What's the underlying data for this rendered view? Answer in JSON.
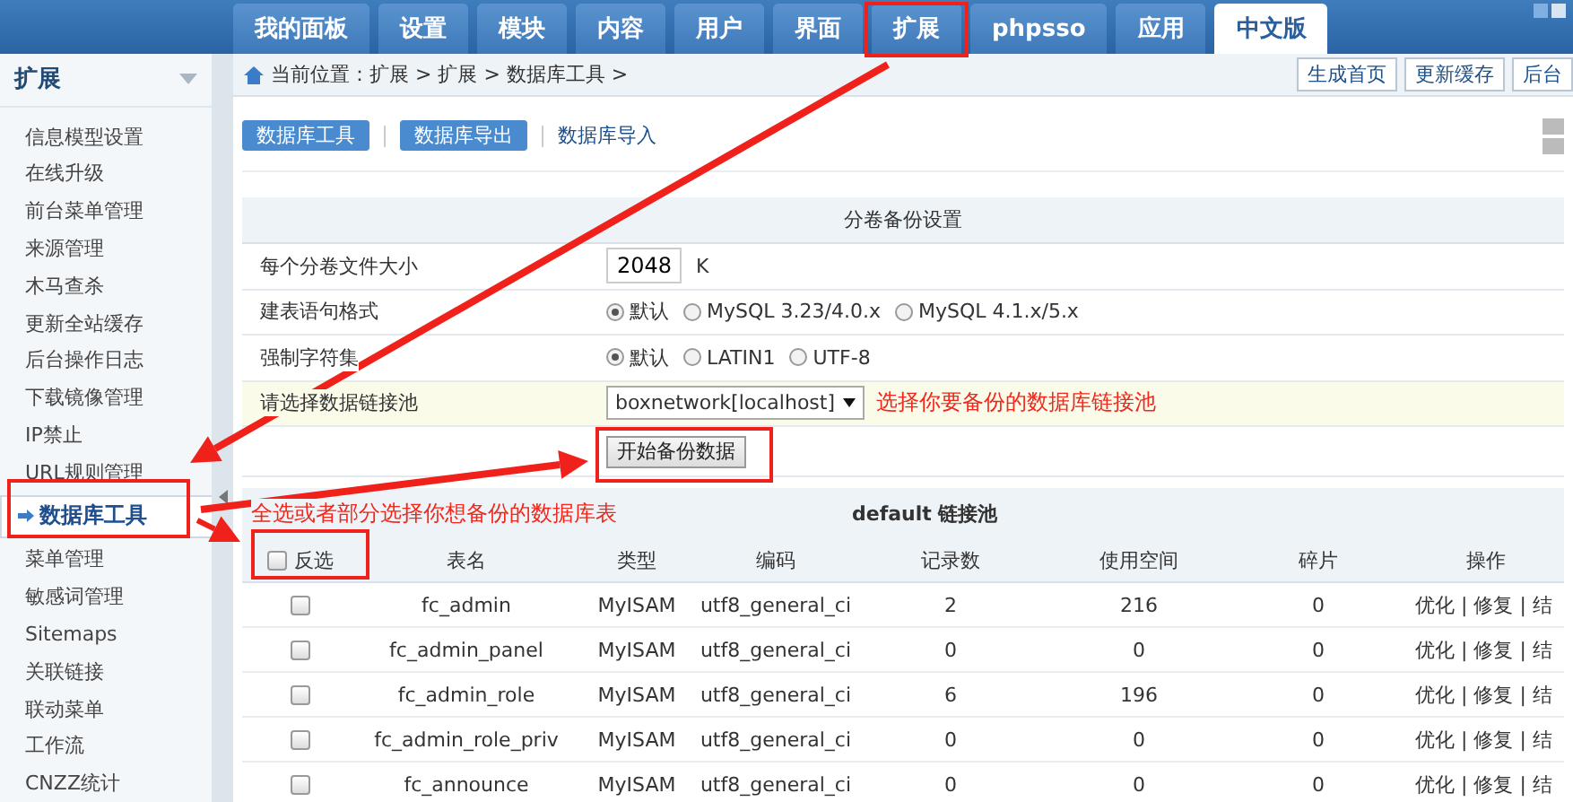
{
  "header": {
    "tabs": [
      {
        "label": "我的面板",
        "selected": false,
        "framed": false
      },
      {
        "label": "设置",
        "selected": false,
        "framed": false
      },
      {
        "label": "模块",
        "selected": false,
        "framed": false
      },
      {
        "label": "内容",
        "selected": false,
        "framed": false
      },
      {
        "label": "用户",
        "selected": false,
        "framed": false
      },
      {
        "label": "界面",
        "selected": false,
        "framed": false
      },
      {
        "label": "扩展",
        "selected": false,
        "framed": true
      },
      {
        "label": "phpsso",
        "selected": false,
        "framed": false
      },
      {
        "label": "应用",
        "selected": false,
        "framed": false
      },
      {
        "label": "中文版",
        "selected": true,
        "framed": false
      }
    ]
  },
  "sidebar": {
    "title": "扩展",
    "items": [
      {
        "label": "信息模型设置",
        "selected": false
      },
      {
        "label": "在线升级",
        "selected": false
      },
      {
        "label": "前台菜单管理",
        "selected": false
      },
      {
        "label": "来源管理",
        "selected": false
      },
      {
        "label": "木马查杀",
        "selected": false
      },
      {
        "label": "更新全站缓存",
        "selected": false
      },
      {
        "label": "后台操作日志",
        "selected": false
      },
      {
        "label": "下载镜像管理",
        "selected": false
      },
      {
        "label": "IP禁止",
        "selected": false
      },
      {
        "label": "URL规则管理",
        "selected": false
      },
      {
        "label": "数据库工具",
        "selected": true
      },
      {
        "label": "菜单管理",
        "selected": false
      },
      {
        "label": "敏感词管理",
        "selected": false
      },
      {
        "label": "Sitemaps",
        "selected": false
      },
      {
        "label": "关联链接",
        "selected": false
      },
      {
        "label": "联动菜单",
        "selected": false
      },
      {
        "label": "工作流",
        "selected": false
      },
      {
        "label": "CNZZ统计",
        "selected": false
      }
    ]
  },
  "breadcrumb": {
    "text": "当前位置：扩展 > 扩展 > 数据库工具 >",
    "buttons": [
      "生成首页",
      "更新缓存",
      "后台"
    ]
  },
  "subnav": [
    {
      "label": "数据库工具",
      "kind": "button"
    },
    {
      "label": "数据库导出",
      "kind": "button"
    },
    {
      "label": "数据库导入",
      "kind": "link"
    }
  ],
  "form": {
    "title": "分卷备份设置",
    "rows": [
      {
        "kind": "input",
        "label": "每个分卷文件大小",
        "value": "2048",
        "unit": "K",
        "highlighted": false
      },
      {
        "kind": "radio",
        "label": "建表语句格式",
        "highlighted": false,
        "options": [
          {
            "label": "默认",
            "selected": true
          },
          {
            "label": "MySQL 3.23/4.0.x",
            "selected": false
          },
          {
            "label": "MySQL 4.1.x/5.x",
            "selected": false
          }
        ]
      },
      {
        "kind": "radio",
        "label": "强制字符集",
        "highlighted": false,
        "options": [
          {
            "label": "默认",
            "selected": true
          },
          {
            "label": "LATIN1",
            "selected": false
          },
          {
            "label": "UTF-8",
            "selected": false
          }
        ]
      },
      {
        "kind": "select",
        "label": "请选择数据链接池",
        "value": "boxnetwork[localhost]",
        "note": "选择你要备份的数据库链接池",
        "highlighted": true
      }
    ],
    "submit": "开始备份数据"
  },
  "table": {
    "note": "全选或者部分选择你想备份的数据库表",
    "title": "default 链接池",
    "select_all": {
      "label": "反选",
      "checked": false
    },
    "columns": [
      "表名",
      "类型",
      "编码",
      "记录数",
      "使用空间",
      "碎片",
      "操作"
    ],
    "rows": [
      {
        "checked": false,
        "cells": [
          "fc_admin",
          "MyISAM",
          "utf8_general_ci",
          "2",
          "216",
          "0",
          "优化 | 修复 | 结"
        ]
      },
      {
        "checked": false,
        "cells": [
          "fc_admin_panel",
          "MyISAM",
          "utf8_general_ci",
          "0",
          "0",
          "0",
          "优化 | 修复 | 结"
        ]
      },
      {
        "checked": false,
        "cells": [
          "fc_admin_role",
          "MyISAM",
          "utf8_general_ci",
          "6",
          "196",
          "0",
          "优化 | 修复 | 结"
        ]
      },
      {
        "checked": false,
        "cells": [
          "fc_admin_role_priv",
          "MyISAM",
          "utf8_general_ci",
          "0",
          "0",
          "0",
          "优化 | 修复 | 结"
        ]
      },
      {
        "checked": false,
        "cells": [
          "fc_announce",
          "MyISAM",
          "utf8_general_ci",
          "0",
          "0",
          "0",
          "优化 | 修复 | 结"
        ]
      }
    ]
  }
}
